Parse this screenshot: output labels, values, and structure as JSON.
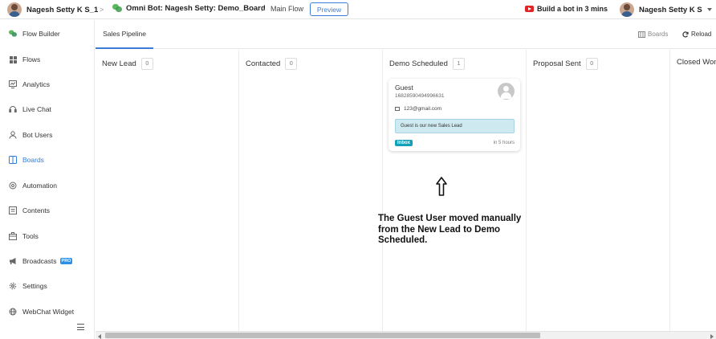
{
  "topbar": {
    "account_name": "Nagesh Setty K S_1",
    "bot_name": "Omni Bot: Nagesh Setty: Demo_Board",
    "flow_name": "Main Flow",
    "preview_label": "Preview",
    "youtube_label": "Build a bot in 3 mins",
    "user_name": "Nagesh Setty K S",
    "separator": ">"
  },
  "sidebar": {
    "items": [
      {
        "label": "Flow Builder",
        "icon": "flow-builder-icon"
      },
      {
        "label": "Flows",
        "icon": "grid-icon"
      },
      {
        "label": "Analytics",
        "icon": "analytics-icon"
      },
      {
        "label": "Live Chat",
        "icon": "headset-icon"
      },
      {
        "label": "Bot Users",
        "icon": "user-icon"
      },
      {
        "label": "Boards",
        "icon": "board-icon",
        "active": true
      },
      {
        "label": "Automation",
        "icon": "automation-icon"
      },
      {
        "label": "Contents",
        "icon": "contents-icon"
      },
      {
        "label": "Tools",
        "icon": "tools-icon"
      },
      {
        "label": "Broadcasts",
        "icon": "megaphone-icon",
        "badge": "PRO"
      },
      {
        "label": "Settings",
        "icon": "gear-icon"
      },
      {
        "label": "WebChat Widget",
        "icon": "webchat-icon"
      }
    ]
  },
  "tabs": {
    "active_tab": "Sales Pipeline",
    "boards_label": "Boards",
    "reload_label": "Reload"
  },
  "board": {
    "columns": [
      {
        "title": "New Lead",
        "count": "0"
      },
      {
        "title": "Contacted",
        "count": "0"
      },
      {
        "title": "Demo Scheduled",
        "count": "1"
      },
      {
        "title": "Proposal Sent",
        "count": "0"
      },
      {
        "title": "Closed Won",
        "count": ""
      }
    ],
    "card": {
      "name": "Guest",
      "id": "1682859049499663​1",
      "email": "123@gmail.com",
      "note": "Guest is our new Sales Lead",
      "tag": "Inbox",
      "time": "in 5 hours"
    }
  },
  "annotation": {
    "text": "The Guest User moved manually from the New Lead to Demo Scheduled."
  },
  "colors": {
    "accent": "#3b7dd8",
    "tag": "#12a1b9",
    "note_bg": "#cfe9f1"
  }
}
